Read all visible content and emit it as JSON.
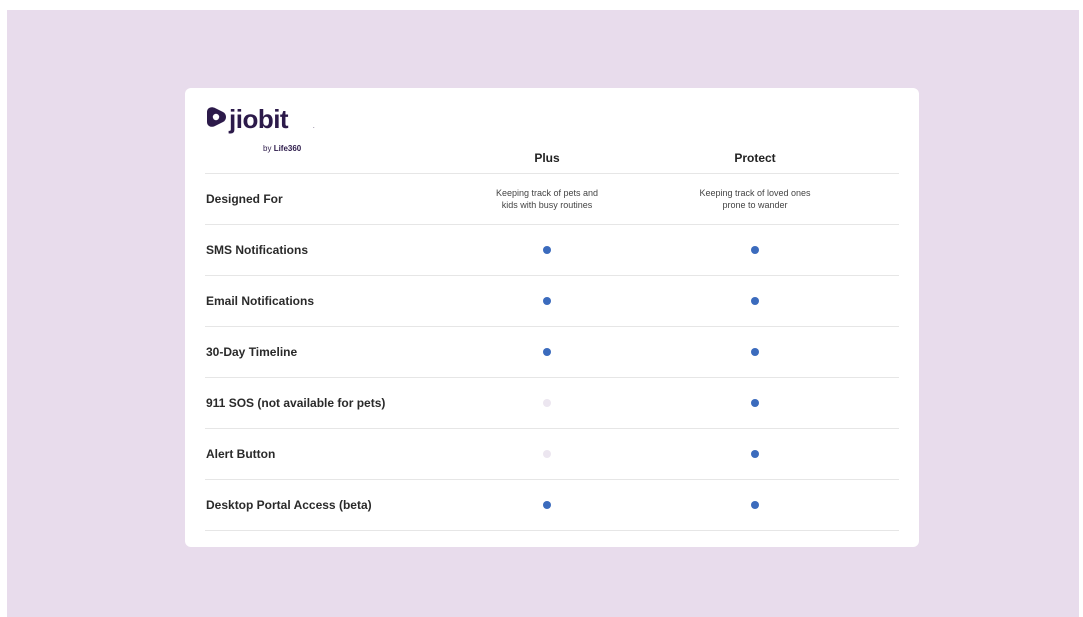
{
  "brand": {
    "name": "jiobit",
    "byline_prefix": "by",
    "byline_brand": "Life360",
    "color": "#2c1a4a"
  },
  "columns": {
    "plus": "Plus",
    "protect": "Protect"
  },
  "colors": {
    "dot_on": "#3b6bbd",
    "dot_off": "#ece6f0",
    "backdrop": "#e8dcec"
  },
  "rows": [
    {
      "label": "Designed For",
      "plus_text": "Keeping track of pets and\nkids with busy routines",
      "protect_text": "Keeping track of loved ones\nprone to wander"
    },
    {
      "label": "SMS Notifications",
      "plus": true,
      "protect": true
    },
    {
      "label": "Email Notifications",
      "plus": true,
      "protect": true
    },
    {
      "label": "30-Day Timeline",
      "plus": true,
      "protect": true
    },
    {
      "label": "911 SOS (not available for pets)",
      "plus": false,
      "protect": true
    },
    {
      "label": "Alert Button",
      "plus": false,
      "protect": true
    },
    {
      "label": "Desktop Portal Access (beta)",
      "plus": true,
      "protect": true
    }
  ]
}
